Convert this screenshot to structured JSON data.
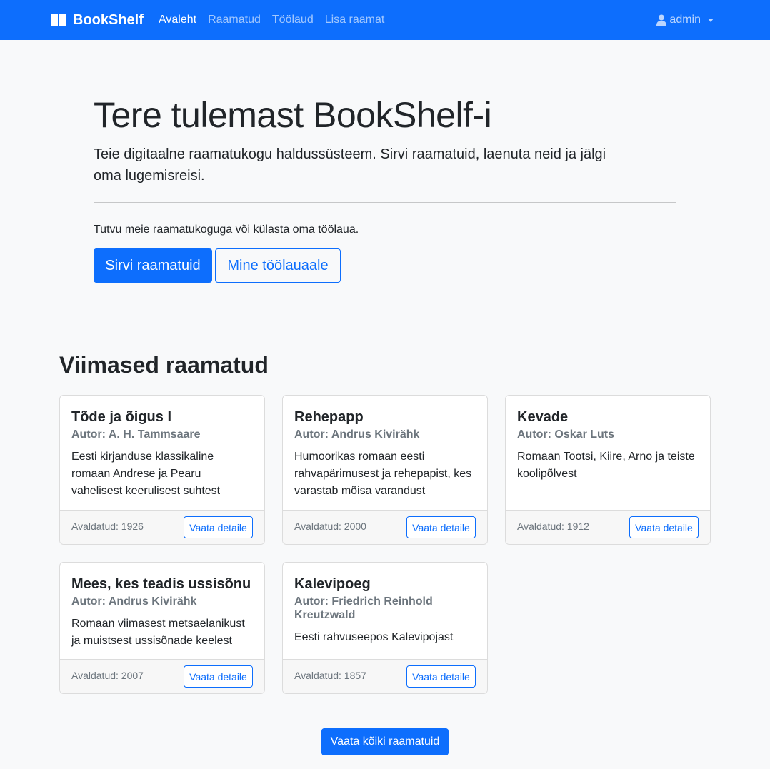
{
  "navbar": {
    "brand": "BookShelf",
    "links": [
      {
        "label": "Avaleht",
        "active": true
      },
      {
        "label": "Raamatud",
        "active": false
      },
      {
        "label": "Töölaud",
        "active": false
      },
      {
        "label": "Lisa raamat",
        "active": false
      }
    ],
    "user": "admin",
    "icons": {
      "brand": "book-icon",
      "user": "user-icon",
      "dropdown": "caret-down-icon"
    }
  },
  "hero": {
    "title": "Tere tulemast BookShelf-i",
    "lead": "Teie digitaalne raamatukogu haldussüsteem. Sirvi raamatuid, laenuta neid ja jälgi oma lugemisreisi.",
    "sub": "Tutvu meie raamatukoguga või külasta oma töölaua.",
    "primary_button": "Sirvi raamatuid",
    "secondary_button": "Mine töölauaale"
  },
  "recent": {
    "title": "Viimased raamatud",
    "books": [
      {
        "title": "Tõde ja õigus I",
        "author": "Autor: A. H. Tammsaare",
        "description": "Eesti kirjanduse klassikaline romaan Andrese ja Pearu vahelisest keerulisest suhtest",
        "published": "Avaldatud: 1926",
        "button": "Vaata detaile"
      },
      {
        "title": "Rehepapp",
        "author": "Autor: Andrus Kivirähk",
        "description": "Humoorikas romaan eesti rahvapärimusest ja rehepapist, kes varastab mõisa varandust",
        "published": "Avaldatud: 2000",
        "button": "Vaata detaile"
      },
      {
        "title": "Kevade",
        "author": "Autor: Oskar Luts",
        "description": "Romaan Tootsi, Kiire, Arno ja teiste koolipõlvest",
        "published": "Avaldatud: 1912",
        "button": "Vaata detaile"
      },
      {
        "title": "Mees, kes teadis ussisõnu",
        "author": "Autor: Andrus Kivirähk",
        "description": "Romaan viimasest metsaelanikust ja muistsest ussisõnade keelest",
        "published": "Avaldatud: 2007",
        "button": "Vaata detaile"
      },
      {
        "title": "Kalevipoeg",
        "author": "Autor: Friedrich Reinhold Kreutzwald",
        "description": "Eesti rahvuseepos Kalevipojast",
        "published": "Avaldatud: 1857",
        "button": "Vaata detaile"
      }
    ],
    "all_button": "Vaata kõiki raamatuid"
  },
  "colors": {
    "primary": "#0d6efd",
    "background": "#f8f9fa",
    "muted": "#6c757d"
  }
}
